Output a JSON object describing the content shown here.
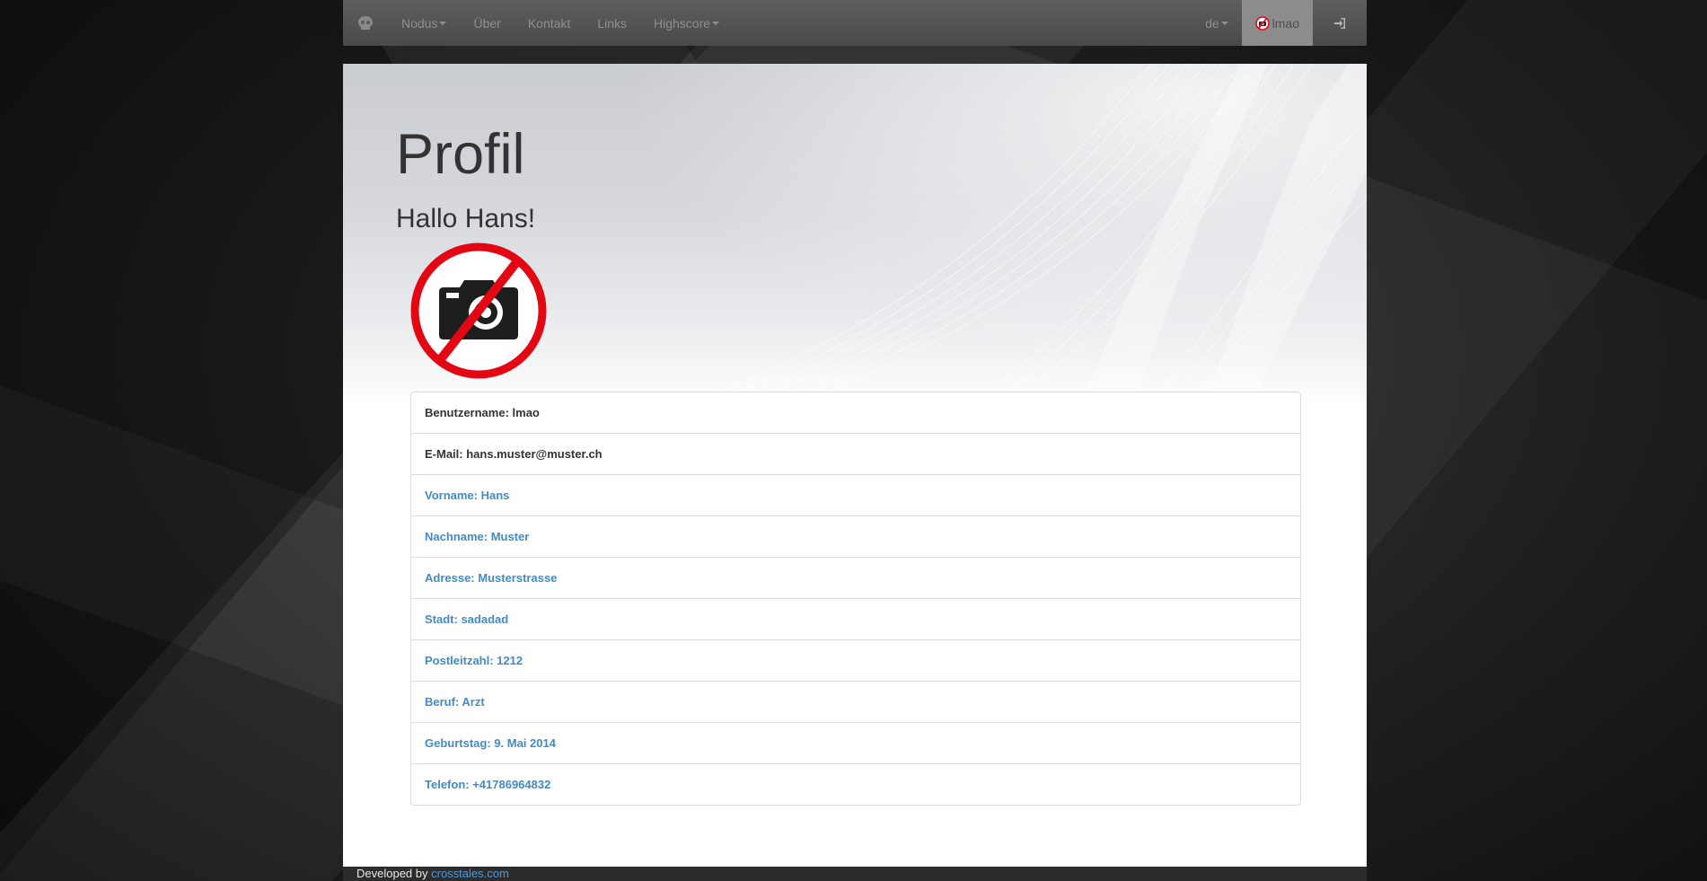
{
  "navbar": {
    "brand_icon": "skull-logo-icon",
    "items": [
      {
        "label": "Nodus",
        "dropdown": true
      },
      {
        "label": "Über",
        "dropdown": false
      },
      {
        "label": "Kontakt",
        "dropdown": false
      },
      {
        "label": "Links",
        "dropdown": false
      },
      {
        "label": "Highscore",
        "dropdown": true
      }
    ],
    "language": "de",
    "user": "lmao",
    "user_icon": "no-photo-icon",
    "logout_icon": "sign-in-icon"
  },
  "main": {
    "title": "Profil",
    "greeting": "Hallo Hans!",
    "profile_photo_icon": "no-camera-icon"
  },
  "profile_fields": [
    {
      "text": "Benutzername: lmao",
      "style": "dark"
    },
    {
      "text": "E-Mail: hans.muster@muster.ch",
      "style": "dark"
    },
    {
      "text": "Vorname: Hans",
      "style": "link"
    },
    {
      "text": "Nachname: Muster",
      "style": "link"
    },
    {
      "text": "Adresse: Musterstrasse",
      "style": "link"
    },
    {
      "text": "Stadt: sadadad",
      "style": "link"
    },
    {
      "text": "Postleitzahl: 1212",
      "style": "link"
    },
    {
      "text": "Beruf: Arzt",
      "style": "link"
    },
    {
      "text": "Geburtstag: 9. Mai 2014",
      "style": "link"
    },
    {
      "text": "Telefon: +41786964832",
      "style": "link"
    }
  ],
  "footer": {
    "prefix": "Developed by ",
    "link": "crosstales.com"
  },
  "colors": {
    "link": "#428bca",
    "navbar": "#4a4a4a",
    "no_sign_red": "#e30613"
  }
}
